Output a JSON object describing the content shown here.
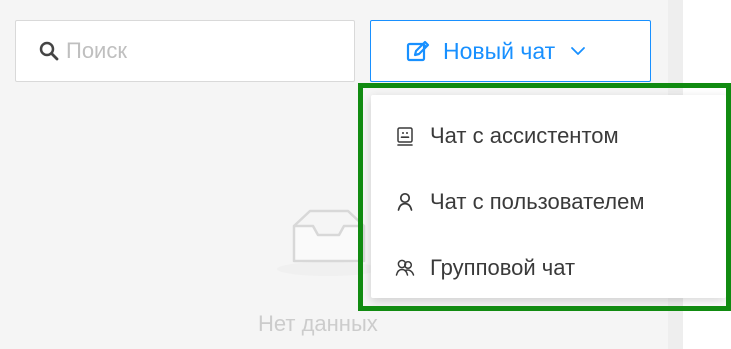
{
  "search": {
    "placeholder": "Поиск",
    "value": ""
  },
  "new_chat": {
    "label": "Новый чат"
  },
  "empty_state": {
    "text": "Нет данных"
  },
  "dropdown": {
    "items": [
      {
        "label": "Чат с ассистентом",
        "icon": "assistant-icon"
      },
      {
        "label": "Чат с пользователем",
        "icon": "user-icon"
      },
      {
        "label": "Групповой чат",
        "icon": "group-icon"
      }
    ]
  },
  "colors": {
    "accent": "#1890ff",
    "highlight": "#118b11",
    "muted_text": "#cccccc",
    "panel_background": "#f5f5f5"
  }
}
